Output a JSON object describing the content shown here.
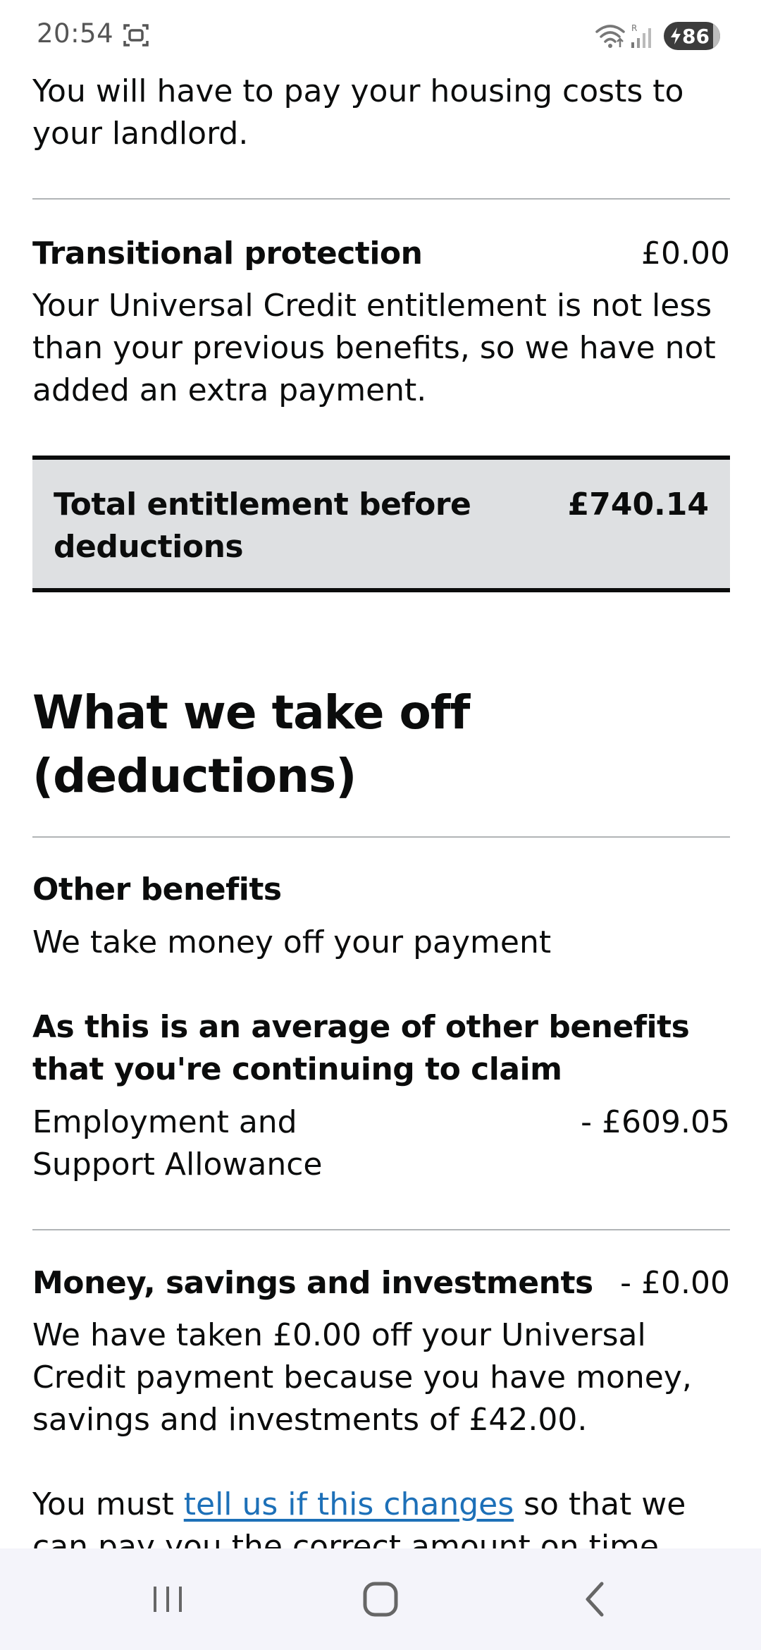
{
  "status_bar": {
    "time": "20:54",
    "battery_level": "86",
    "icons": [
      "screenshot-icon",
      "wifi-icon",
      "signal-icon",
      "battery-charging-icon"
    ]
  },
  "housing": {
    "text": "You will have to pay your housing costs to your landlord."
  },
  "transitional_protection": {
    "title": "Transitional protection",
    "amount": "£0.00",
    "description": "Your Universal Credit entitlement is not less than your previous benefits, so we have not added an extra payment."
  },
  "total": {
    "label": "Total entitlement before deductions",
    "amount": "£740.14"
  },
  "deductions": {
    "heading": "What we take off (deductions)",
    "other_benefits": {
      "title": "Other benefits",
      "description": "We take money off your payment",
      "subheading": "As this is an average of other benefits that you're continuing to claim",
      "item_label": "Employment and Support Allowance",
      "item_amount": "- £609.05"
    },
    "savings": {
      "title": "Money, savings and investments",
      "amount": "- £0.00",
      "description": "We have taken £0.00 off your Universal Credit payment because you have money, savings and investments of £42.00.",
      "notice_before": "You must ",
      "notice_link": "tell us if this changes",
      "notice_after": " so that we can pay you the correct amount on time."
    }
  },
  "nav_bar": {
    "buttons": [
      "recent-apps-icon",
      "home-icon",
      "back-icon"
    ]
  }
}
